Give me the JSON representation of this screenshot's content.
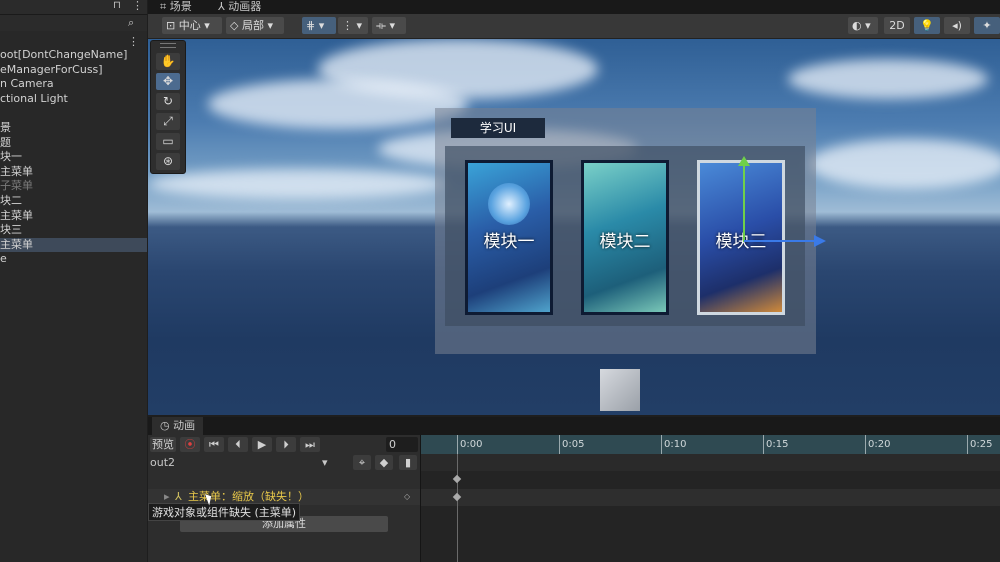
{
  "hierarchy": {
    "items": [
      {
        "label": "oot[DontChangeName]",
        "state": "normal"
      },
      {
        "label": "eManagerForCuss]",
        "state": "normal"
      },
      {
        "label": "n Camera",
        "state": "normal"
      },
      {
        "label": "ctional Light",
        "state": "normal"
      },
      {
        "label": "",
        "state": "normal"
      },
      {
        "label": "景",
        "state": "normal"
      },
      {
        "label": "题",
        "state": "normal"
      },
      {
        "label": "块一",
        "state": "normal"
      },
      {
        "label": "主菜单",
        "state": "normal"
      },
      {
        "label": "子菜单",
        "state": "dim"
      },
      {
        "label": "块二",
        "state": "normal"
      },
      {
        "label": "主菜单",
        "state": "normal"
      },
      {
        "label": "块三",
        "state": "normal"
      },
      {
        "label": "主菜单",
        "state": "selected"
      },
      {
        "label": "e",
        "state": "normal"
      }
    ]
  },
  "tabs": {
    "scene": "场景",
    "animator": "动画器"
  },
  "toolbar": {
    "pivot": "中心",
    "space": "局部",
    "mode_2d": "2D"
  },
  "scene": {
    "panel_title": "学习UI",
    "cards": [
      "模块一",
      "模块二",
      "模块三"
    ]
  },
  "animation": {
    "tab_label": "动画",
    "preview_label": "预览",
    "frame_value": "0",
    "clip_name": "out2",
    "track_label": "主菜单：缩放（缺失！）",
    "add_property_label": "添加属性",
    "tooltip": "游戏对象或组件缺失 (主菜单)",
    "ruler_ticks": [
      "0:00",
      "0:05",
      "0:10",
      "0:15",
      "0:20",
      "0:25"
    ]
  }
}
